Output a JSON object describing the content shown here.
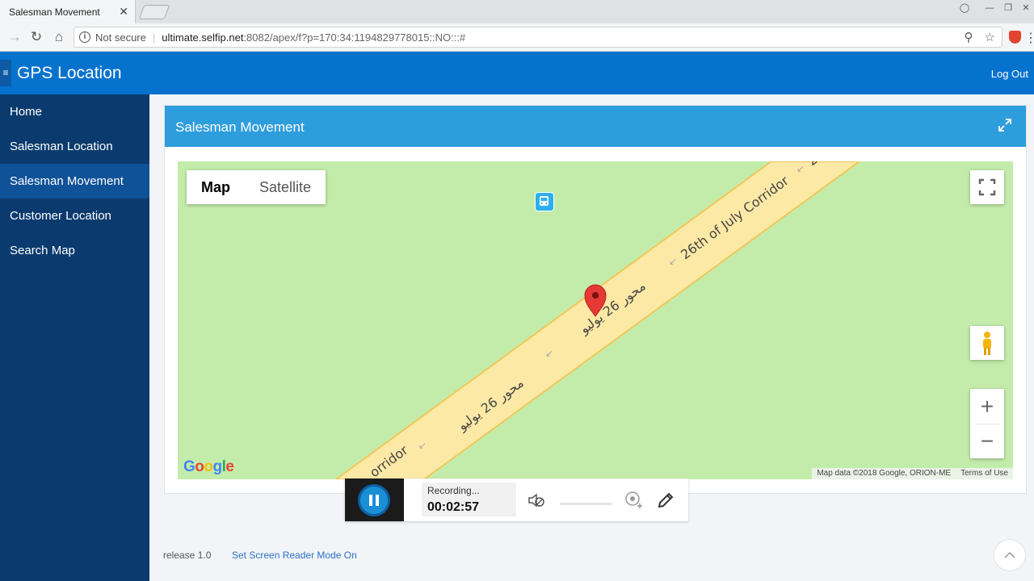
{
  "browser": {
    "tab_title": "Salesman Movement",
    "tab_close": "✕",
    "security_label": "Not secure",
    "url_host": "ultimate.selfip.net",
    "url_rest": ":8082/apex/f?p=170:34:1194829778015::NO:::#"
  },
  "app": {
    "title": "GPS Location",
    "logout_label": "Log Out"
  },
  "sidebar": {
    "items": [
      {
        "label": "Home"
      },
      {
        "label": "Salesman Location"
      },
      {
        "label": "Salesman Movement"
      },
      {
        "label": "Customer Location"
      },
      {
        "label": "Search Map"
      }
    ],
    "active_index": 2
  },
  "region": {
    "title": "Salesman Movement"
  },
  "map": {
    "type_map": "Map",
    "type_satellite": "Satellite",
    "road_label_en": "26th of July Corridor",
    "road_label_ar": "محور 26 يوليو",
    "road_label_partial": "orridor",
    "road_label_top": "2",
    "attribution": "Map data ©2018 Google, ORION-ME",
    "terms": "Terms of Use",
    "zoom_in": "+",
    "zoom_out": "−",
    "logo": {
      "g1": "G",
      "o1": "o",
      "o2": "o",
      "g2": "g",
      "l": "l",
      "e": "e"
    },
    "colors": {
      "land": "#c3ecaa",
      "road_fill": "#fde9a6",
      "road_edge": "#f0c85a",
      "marker": "#e53935"
    }
  },
  "recording": {
    "status_label": "Recording...",
    "elapsed": "00:02:57"
  },
  "footer": {
    "release": "release 1.0",
    "screen_reader": "Set Screen Reader Mode On"
  }
}
